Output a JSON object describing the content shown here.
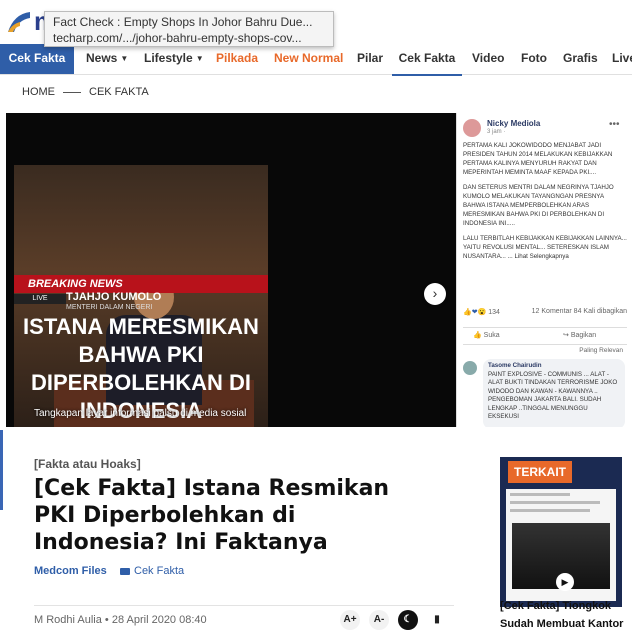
{
  "tooltip": {
    "title": "Fact Check : Empty Shops In Johor Bahru Due...",
    "url": "techarp.com/.../johor-bahru-empty-shops-cov..."
  },
  "nav": {
    "brand": "Cek Fakta",
    "items": [
      {
        "label": "News",
        "dropdown": true
      },
      {
        "label": "Lifestyle",
        "dropdown": true
      },
      {
        "label": "Pilkada",
        "color": "#e8692a"
      },
      {
        "label": "New Normal",
        "color": "#e8692a"
      },
      {
        "label": "Pilar"
      },
      {
        "label": "Cek Fakta",
        "active": true
      },
      {
        "label": "Video"
      },
      {
        "label": "Foto"
      },
      {
        "label": "Grafis"
      },
      {
        "label": "Live"
      }
    ]
  },
  "breadcrumb": {
    "home": "HOME",
    "current": "CEK FAKTA"
  },
  "hero": {
    "breaking": "BREAKING NEWS",
    "live": "LIVE",
    "speaker_name": "TJAHJO KUMOLO",
    "speaker_role": "MENTERI DALAM NEGERI",
    "overlay_text": "ISTANA MERESMIKAN BAHWA PKI DIPERBOLEHKAN DI INDONESIA",
    "caption": "Tangkapan layar informasi palsu di media sosial"
  },
  "fb_post": {
    "name": "Nicky Mediola",
    "time": "3 jam ·",
    "para1": "PERTAMA KALI JOKOWIDODO MENJABAT JADI PRESIDEN TAHUN 2014 MELAKUKAN KEBIJAKKAN PERTAMA KALINYA MENYURUH RAKYAT DAN MEPERINTAH MEMINTA MAAF KEPADA PKI....",
    "para2": "DAN SETERUS MENTRI DALAM NEGRINYA TJAHJO KUMOLO MELAKUKAN TAYANGNGAN PRESNYA BAHWA ISTANA MEMPERBOLEHKAN ARAS MERESMIKAN BAHWA PKI DI PERBOLEHKAN DI INDONESIA INI.....",
    "para3": "LALU TERBITLAH KEBIJAKKAN KEBIJAKKAN LAINNYA... YAITU REVOLUSI MENTAL... SETERESKAN ISLAM NUSANTARA... ... Lihat Selengkapnya",
    "reactions": "134",
    "comments": "12 Komentar  84 Kali dibagikan",
    "like": "Suka",
    "share": "Bagikan",
    "relevant": "Paling Relevan",
    "commenter": "Tasome Chairudin",
    "comment": "PAINT EXPLOSIVE - COMMUNIS ... ALAT - ALAT BUKTI TINDAKAN TERRORISME JOKO WIDODO DAN KAWAN - KAWANNYA .. PENGEBOMAN JAKARTA BALI. SUDAH LENGKAP ..TINGGAL MENUNGGU EKSEKUSI"
  },
  "article": {
    "category": "[Fakta atau Hoaks]",
    "title": "[Cek Fakta] Istana Resmikan PKI Diperbolehkan di Indonesia? Ini Faktanya",
    "source": "Medcom Files",
    "tag": "Cek Fakta",
    "byline": "M Rodhi Aulia • 28 April 2020 08:40",
    "font_up": "A+",
    "font_down": "A-"
  },
  "related": {
    "label": "TERKAIT",
    "title": "[Cek Fakta] Tiongkok Sudah Membuat Kantor"
  }
}
